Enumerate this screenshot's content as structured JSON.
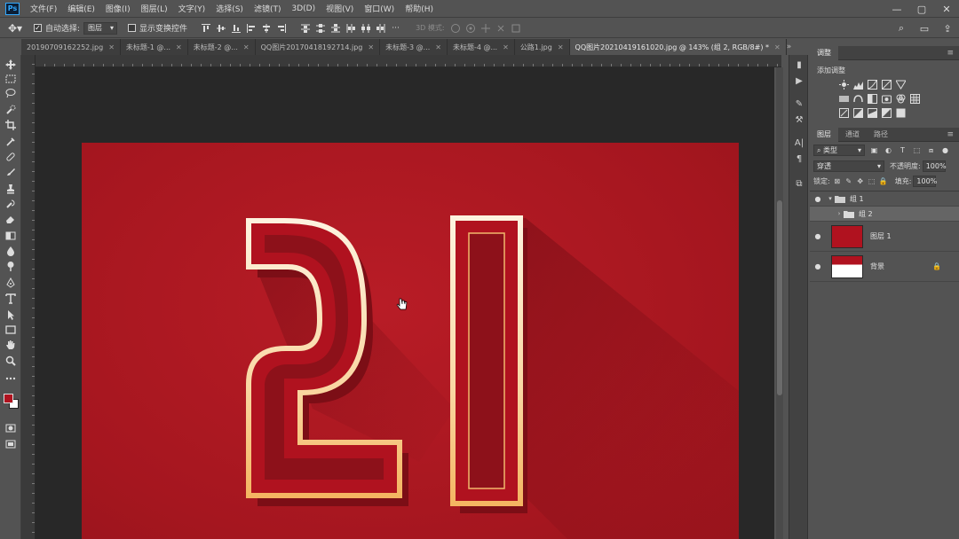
{
  "app": {
    "logo": "Ps",
    "menu": [
      "文件(F)",
      "编辑(E)",
      "图像(I)",
      "图层(L)",
      "文字(Y)",
      "选择(S)",
      "滤镜(T)",
      "3D(D)",
      "视图(V)",
      "窗口(W)",
      "帮助(H)"
    ],
    "window_controls": [
      "—",
      "▢",
      "✕"
    ]
  },
  "options": {
    "auto_select_label": "自动选择:",
    "auto_select_checked": "✓",
    "auto_select_target": "图层",
    "show_transform_label": "显示变换控件",
    "mode_3d_label": "3D 模式:",
    "right_icons": [
      "⌕",
      "▭",
      "⇪"
    ]
  },
  "tabs": [
    {
      "label": "20190709162252.jpg",
      "close": "✕"
    },
    {
      "label": "未标题-1 @...",
      "close": "✕"
    },
    {
      "label": "未标题-2 @...",
      "close": "✕"
    },
    {
      "label": "QQ图片20170418192714.jpg",
      "close": "✕"
    },
    {
      "label": "未标题-3 @...",
      "close": "✕"
    },
    {
      "label": "未标题-4 @...",
      "close": "✕"
    },
    {
      "label": "公路1.jpg",
      "close": "✕"
    },
    {
      "label": "QQ图片20210419161020.jpg @ 143% (组 2, RGB/8#) *",
      "close": "✕",
      "active": true
    }
  ],
  "tabs_more": "»",
  "colors": {
    "foreground": "#b0121f",
    "background": "#ffffff",
    "canvas_red": "#a5161f",
    "outline_gold": "#f6c27a"
  },
  "tools": [
    "move-icon",
    "marquee-icon",
    "lasso-icon",
    "quick-select-icon",
    "crop-icon",
    "eyedropper-icon",
    "healing-icon",
    "brush-icon",
    "stamp-icon",
    "history-brush-icon",
    "eraser-icon",
    "gradient-icon",
    "blur-icon",
    "dodge-icon",
    "pen-icon",
    "type-icon",
    "path-select-icon",
    "rectangle-icon",
    "hand-icon",
    "zoom-icon",
    "more-icon"
  ],
  "artwork": {
    "text": "21"
  },
  "panels": {
    "adjust_tab": "调整",
    "adjust_title": "添加调整",
    "layer_tabs": [
      "图层",
      "通道",
      "路径"
    ],
    "panel_menu": "≡",
    "filter_kind": "类型",
    "blend_mode": "穿透",
    "opacity_label": "不透明度:",
    "opacity_value": "100%",
    "lock_label": "锁定:",
    "fill_label": "填充:",
    "fill_value": "100%",
    "layers": [
      {
        "name": "组 1",
        "type": "group",
        "expanded": true,
        "eye": "●"
      },
      {
        "name": "组 2",
        "type": "group",
        "expanded": false,
        "selected": true,
        "eye": ""
      },
      {
        "name": "图层 1",
        "type": "layer",
        "eye": "●"
      },
      {
        "name": "背景",
        "type": "background",
        "eye": "●",
        "locked": "🔒"
      }
    ]
  }
}
